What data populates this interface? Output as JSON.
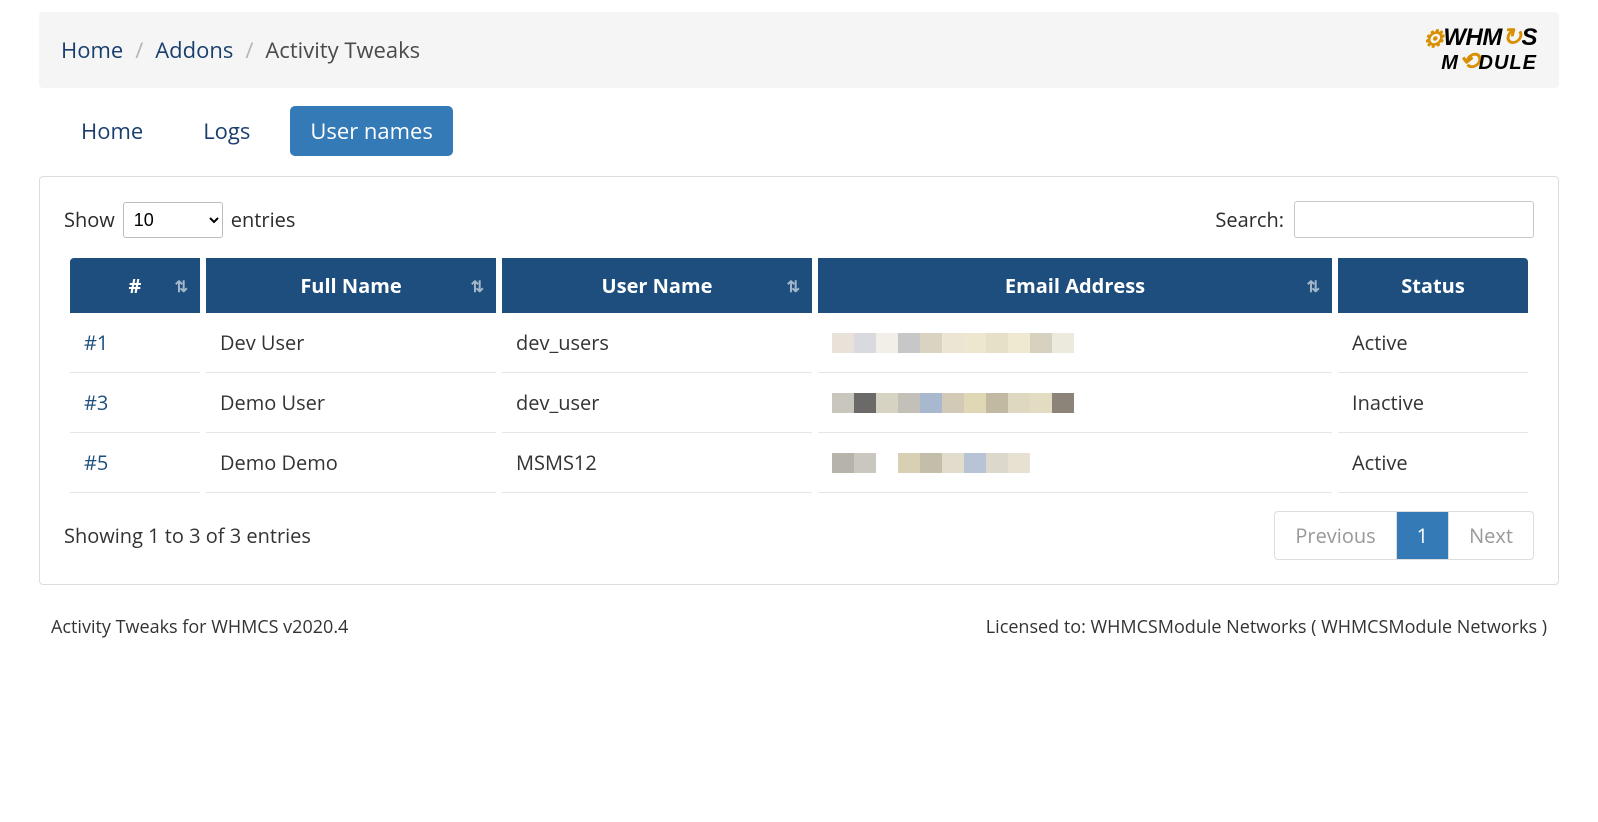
{
  "breadcrumb": {
    "items": [
      "Home",
      "Addons",
      "Activity Tweaks"
    ]
  },
  "logo": {
    "line1_pre": "WHM",
    "line1_post": "S",
    "line2_pre": "M",
    "line2_post": "DULE"
  },
  "tabs": [
    {
      "label": "Home",
      "active": false
    },
    {
      "label": "Logs",
      "active": false
    },
    {
      "label": "User names",
      "active": true
    }
  ],
  "length_control": {
    "show": "Show",
    "entries": "entries",
    "value": "10"
  },
  "search": {
    "label": "Search:",
    "value": ""
  },
  "columns": [
    {
      "label": "#"
    },
    {
      "label": "Full Name"
    },
    {
      "label": "User Name"
    },
    {
      "label": "Email Address"
    },
    {
      "label": "Status"
    }
  ],
  "rows": [
    {
      "id": "#1",
      "full_name": "Dev User",
      "user_name": "dev_users",
      "email": "",
      "status": "Active"
    },
    {
      "id": "#3",
      "full_name": "Demo User",
      "user_name": "dev_user",
      "email": "",
      "status": "Inactive"
    },
    {
      "id": "#5",
      "full_name": "Demo Demo",
      "user_name": "MSMS12",
      "email": "",
      "status": "Active"
    }
  ],
  "info": "Showing 1 to 3 of 3 entries",
  "pagination": {
    "previous": "Previous",
    "next": "Next",
    "pages": [
      "1"
    ],
    "current": "1"
  },
  "footer": {
    "left": "Activity Tweaks for WHMCS v2020.4",
    "right": "Licensed to: WHMCSModule Networks ( WHMCSModule Networks )"
  },
  "pixel_palettes": [
    [
      "#e8e2d8",
      "#dad9e0",
      "#f2efe8",
      "#c7c7c7",
      "#d9d3c2",
      "#ece5d4",
      "#eee7cf",
      "#e6e0c8",
      "#f0e9d1",
      "#d7d2c0",
      "#eceadd"
    ],
    [
      "#c9c6bd",
      "#6b6a68",
      "#d7d3c2",
      "#c3c0b9",
      "#a8b8cf",
      "#d2cab6",
      "#e0d8b4",
      "#c1b9a1",
      "#dfd8c0",
      "#e3dcc2",
      "#8c8479"
    ],
    [
      "#b6b3aa",
      "#cac7be",
      "#ffffff",
      "#d8cfb4",
      "#c2bea9",
      "#e1dccb",
      "#b7c4d6",
      "#dcd8cb",
      "#e6e1d0",
      "#ffffff",
      "#ffffff"
    ]
  ]
}
